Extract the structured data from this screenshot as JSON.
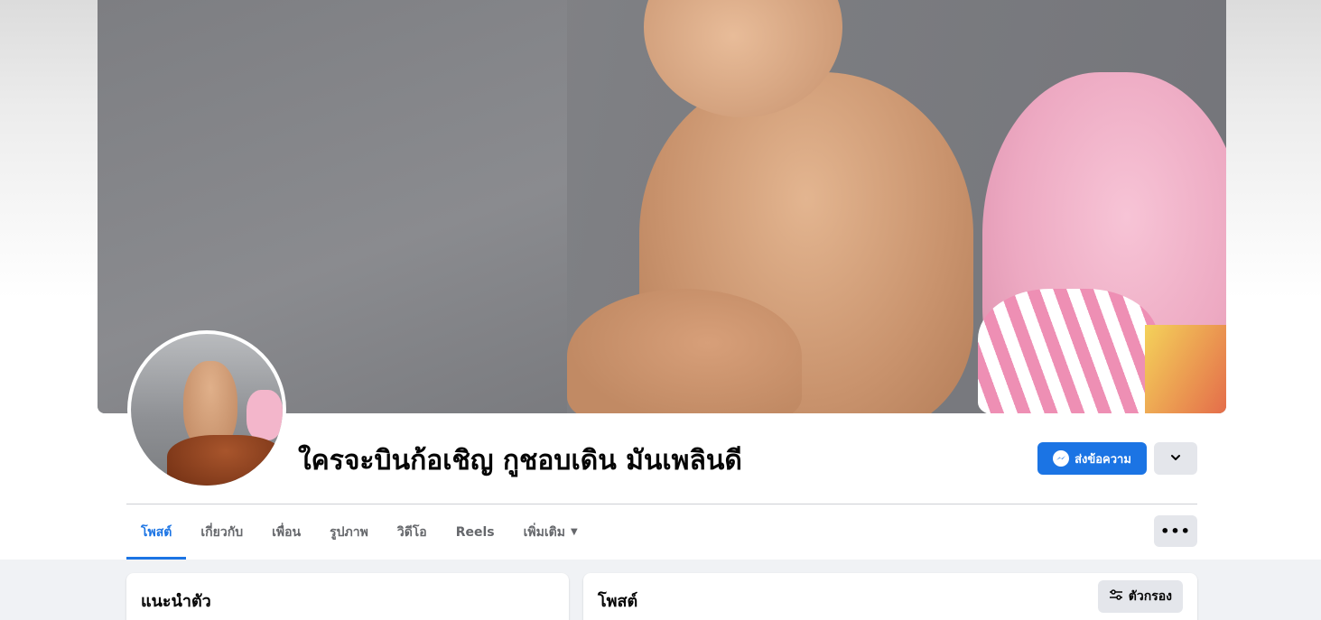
{
  "profile": {
    "name": "ใครจะบินก้อเชิญ กูชอบเดิน มันเพลินดี",
    "message_button_label": "ส่งข้อความ",
    "accent_color": "#1b74e4"
  },
  "tabs": [
    {
      "label": "โพสต์",
      "active": true
    },
    {
      "label": "เกี่ยวกับ",
      "active": false
    },
    {
      "label": "เพื่อน",
      "active": false
    },
    {
      "label": "รูปภาพ",
      "active": false
    },
    {
      "label": "วิดีโอ",
      "active": false
    },
    {
      "label": "Reels",
      "active": false
    },
    {
      "label": "เพิ่มเติม",
      "active": false
    }
  ],
  "tabs_more_label": "•••",
  "intro": {
    "title": "แนะนำตัว"
  },
  "posts": {
    "title": "โพสต์",
    "filter_label": "ตัวกรอง"
  },
  "icons": {
    "message": "messenger-icon",
    "profile_menu": "chevron-down-icon",
    "more": "ellipsis-icon",
    "filter": "filter-sliders-icon"
  }
}
